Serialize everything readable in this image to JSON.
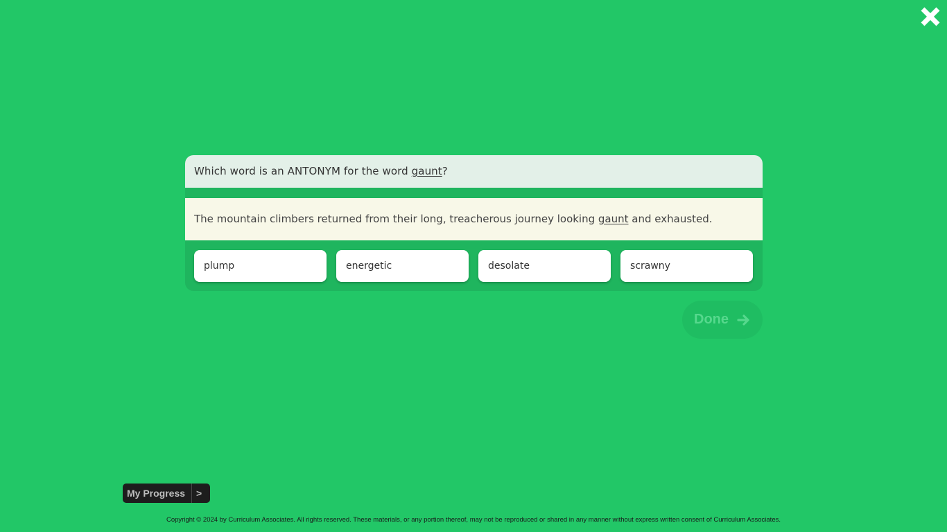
{
  "header": {
    "close_icon": "close-x-icon",
    "close_color": "#ffffff"
  },
  "question": {
    "prefix": "Which word is an ANTONYM for the word ",
    "target_word": "gaunt",
    "suffix": "?"
  },
  "passage": {
    "before": "The mountain climbers returned from their long, treacherous journey looking ",
    "target_word": "gaunt",
    "after": " and exhausted."
  },
  "choices": [
    {
      "label": "plump"
    },
    {
      "label": "energetic"
    },
    {
      "label": "desolate"
    },
    {
      "label": "scrawny"
    }
  ],
  "done_button": {
    "label": "Done",
    "icon": "arrow-right-icon"
  },
  "progress_button": {
    "label": "My Progress",
    "chevron": ">"
  },
  "footer": {
    "copyright": "Copyright © 2024 by Curriculum Associates. All rights reserved. These materials, or any portion thereof, may not be reproduced or shared in any manner without express written consent of Curriculum Associates."
  },
  "colors": {
    "background": "#22c767",
    "card": "#1fb55e",
    "question_bg": "#e3f0e8",
    "passage_bg": "#f8f8e8",
    "done_disabled_text": "#56d88d"
  }
}
